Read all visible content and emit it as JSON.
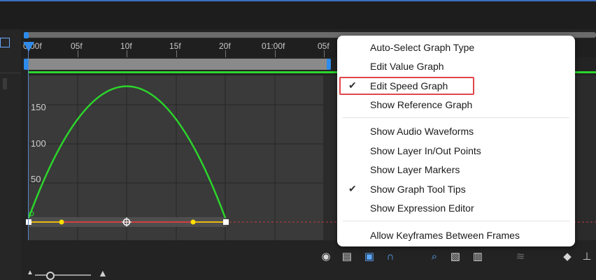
{
  "ruler": {
    "ticks": [
      "0:00f",
      "05f",
      "10f",
      "15f",
      "20f",
      "01:00f",
      "05f"
    ]
  },
  "graph": {
    "y_labels": [
      "150",
      "100",
      "50"
    ],
    "colors": {
      "curve": "#2bd62b",
      "baseline": "#ff3a3a",
      "handle": "#ffe000",
      "work_area": "#2d8ceb"
    }
  },
  "context_menu": {
    "items": [
      {
        "label": "Auto-Select Graph Type",
        "checked": false
      },
      {
        "label": "Edit Value Graph",
        "checked": false
      },
      {
        "label": "Edit Speed Graph",
        "checked": true,
        "highlighted": true
      },
      {
        "label": "Show Reference Graph",
        "checked": false
      },
      {
        "label": "Show Audio Waveforms",
        "checked": false
      },
      {
        "label": "Show Layer In/Out Points",
        "checked": false
      },
      {
        "label": "Show Layer Markers",
        "checked": false
      },
      {
        "label": "Show Graph Tool Tips",
        "checked": true
      },
      {
        "label": "Show Expression Editor",
        "checked": false
      },
      {
        "label": "Allow Keyframes Between Frames",
        "checked": false
      }
    ],
    "check_glyph": "✔"
  },
  "toolbar": {
    "icons": [
      "eye-icon",
      "graph-options-icon",
      "transform-box-icon",
      "snap-magnet-icon",
      "fit-selection-icon",
      "fit-all-icon",
      "fit-full-icon",
      "separate-dimensions-icon",
      "keyframe-diamond-icon",
      "easy-ease-icon"
    ]
  }
}
